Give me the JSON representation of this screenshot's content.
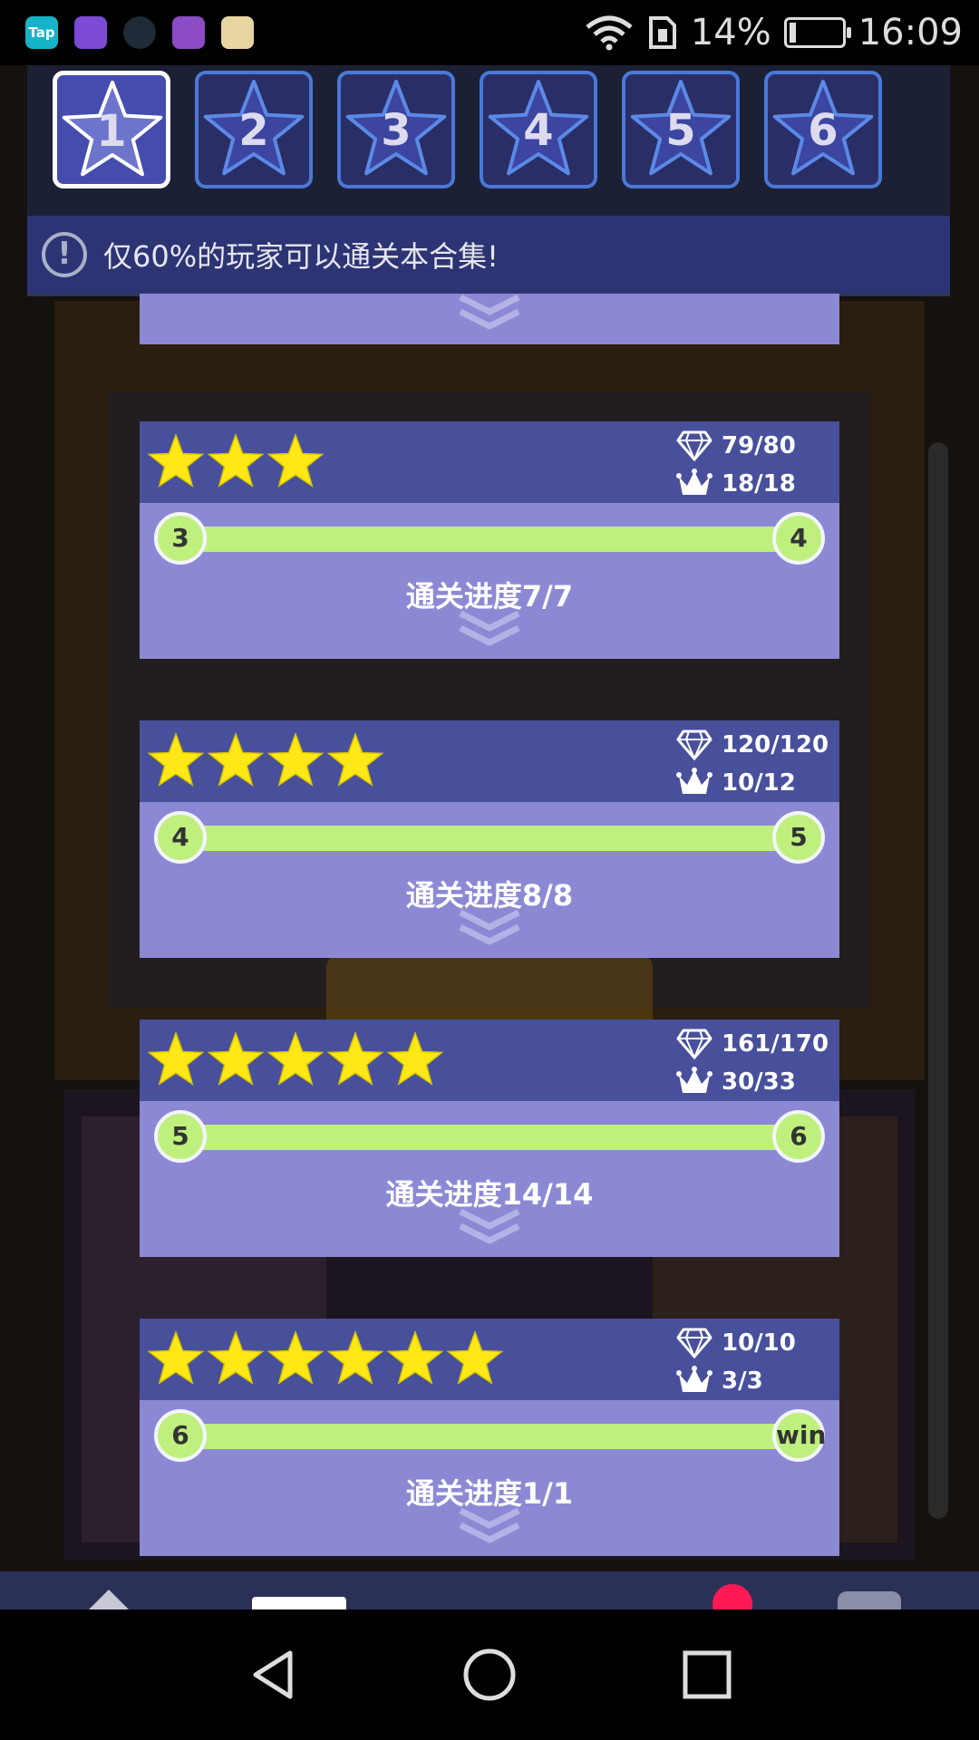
{
  "status_bar": {
    "apps": [
      "tap-app-icon",
      "globe-app-icon",
      "game-app-icon",
      "gallery-app-icon",
      "star-app-icon"
    ],
    "app_tap_label": "Tap",
    "battery": "14%",
    "time": "16:09"
  },
  "tabs": [
    {
      "label": "1",
      "active": true
    },
    {
      "label": "2",
      "active": false
    },
    {
      "label": "3",
      "active": false
    },
    {
      "label": "4",
      "active": false
    },
    {
      "label": "5",
      "active": false
    },
    {
      "label": "6",
      "active": false
    }
  ],
  "notice": {
    "text": "仅60%的玩家可以通关本合集!"
  },
  "cards": [
    {
      "stars": 3,
      "diamonds": "79/80",
      "crowns": "18/18",
      "from": "3",
      "to": "4",
      "progress": "通关进度7/7"
    },
    {
      "stars": 4,
      "diamonds": "120/120",
      "crowns": "10/12",
      "from": "4",
      "to": "5",
      "progress": "通关进度8/8"
    },
    {
      "stars": 5,
      "diamonds": "161/170",
      "crowns": "30/33",
      "from": "5",
      "to": "6",
      "progress": "通关进度14/14"
    },
    {
      "stars": 6,
      "diamonds": "10/10",
      "crowns": "3/3",
      "from": "6",
      "to": "win",
      "progress": "通关进度1/1"
    }
  ],
  "colors": {
    "card_top": "#48509c",
    "card_bottom": "#8c89d4",
    "bar": "#bff07e",
    "star": "#ffe815"
  }
}
